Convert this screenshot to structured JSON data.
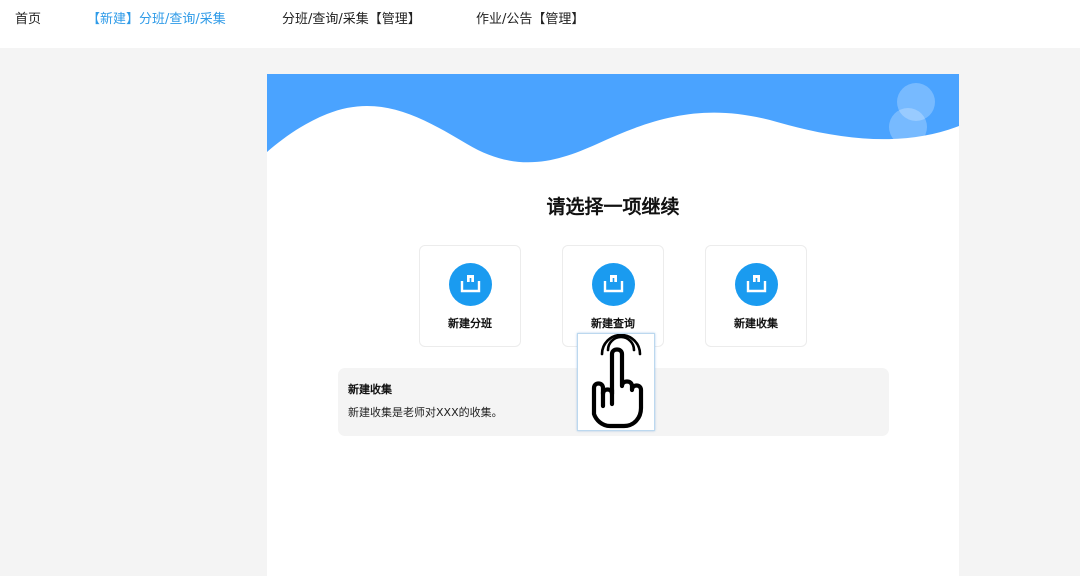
{
  "nav": {
    "items": [
      {
        "label": "首页"
      },
      {
        "label": "【新建】分班/查询/采集"
      },
      {
        "label": "分班/查询/采集【管理】"
      },
      {
        "label": "作业/公告【管理】"
      }
    ]
  },
  "main": {
    "title": "请选择一项继续",
    "cards": [
      {
        "label": "新建分班"
      },
      {
        "label": "新建查询"
      },
      {
        "label": "新建收集"
      }
    ],
    "description": {
      "title": "新建收集",
      "text": "新建收集是老师对XXX的收集。"
    }
  },
  "icons": {
    "card_icon": "upload-tray-icon",
    "cursor": "hand-pointer-icon"
  },
  "colors": {
    "accent": "#2f9be8",
    "wave": "#4aa3ff",
    "icon_bg": "#1a9bf0"
  }
}
